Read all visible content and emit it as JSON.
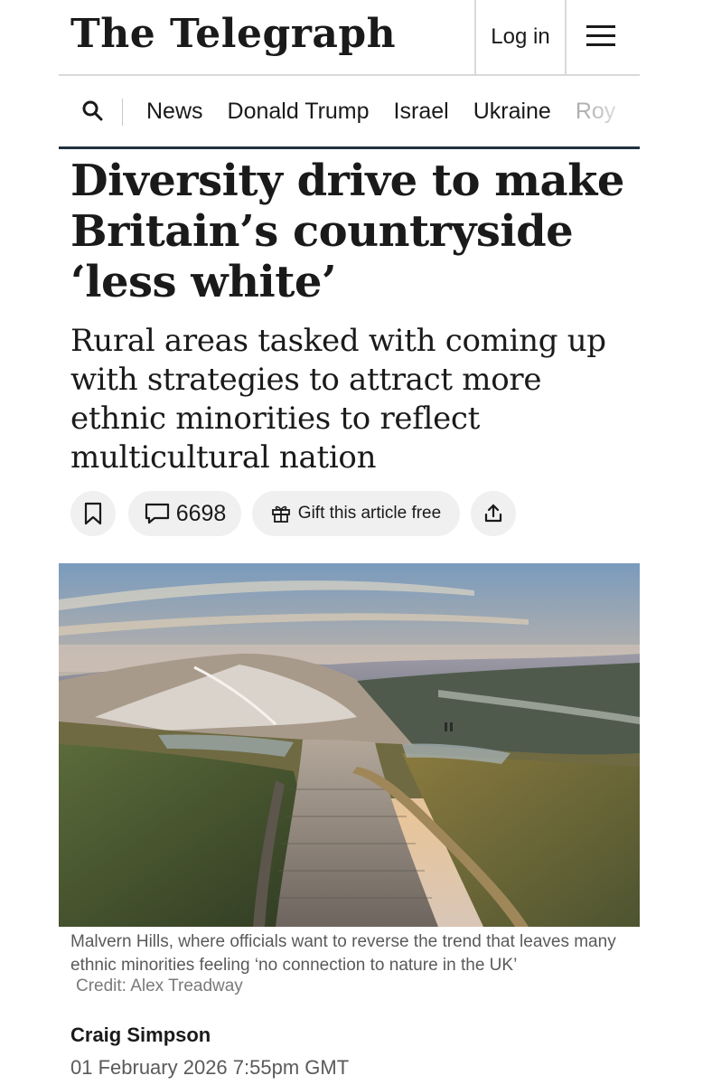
{
  "header": {
    "logo": "The Telegraph",
    "login_label": "Log in",
    "menu_icon": "hamburger-menu-icon"
  },
  "nav": {
    "search_icon": "search-icon",
    "items": [
      "News",
      "Donald Trump",
      "Israel",
      "Ukraine",
      "Roy"
    ]
  },
  "article": {
    "headline": "Diversity drive to make Britain’s countryside ‘less white’",
    "standfirst": "Rural areas tasked with coming up with strategies to attract more ethnic minorities to reflect multicultural nation",
    "actions": {
      "bookmark_icon": "bookmark-icon",
      "comments_icon": "comment-icon",
      "comments_count": "6698",
      "gift_icon": "gift-icon",
      "gift_label": "Gift this article free",
      "share_icon": "share-icon"
    },
    "image": {
      "caption": "Malvern Hills, where officials want to reverse the trend that leaves many ethnic minorities feeling ‘no connection to nature in the UK’",
      "credit": "Credit: Alex Treadway"
    },
    "author": "Craig Simpson",
    "date": "01 February 2026 7:55pm GMT"
  },
  "colors": {
    "text": "#1a1a1a",
    "nav_rule": "#1f3140",
    "pill_bg": "#f0f0f0",
    "caption": "#5a5a5a"
  }
}
